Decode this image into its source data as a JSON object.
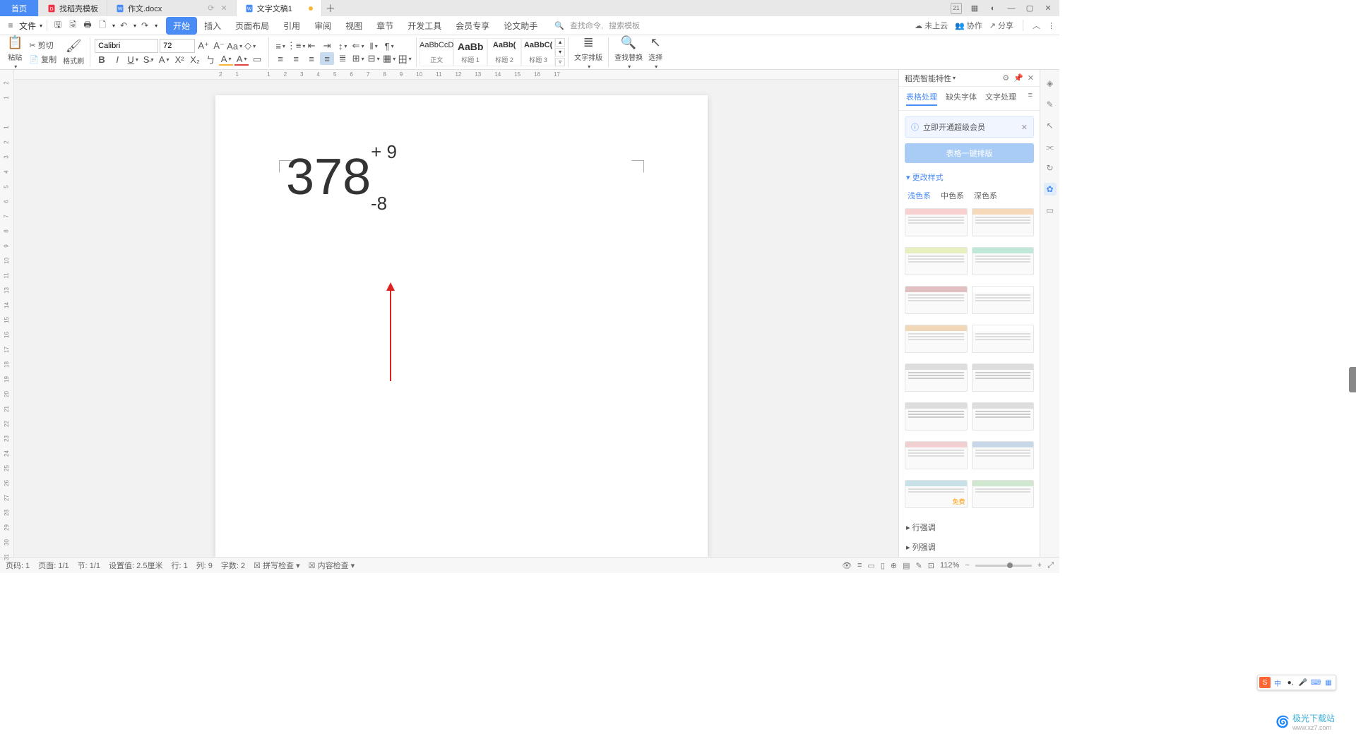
{
  "tabs": {
    "home": "首页",
    "t1": "找稻壳模板",
    "t2": "作文.docx",
    "t3": "文字文稿1"
  },
  "menu": {
    "file": "文件",
    "tabs": [
      "开始",
      "插入",
      "页面布局",
      "引用",
      "审阅",
      "视图",
      "章节",
      "开发工具",
      "会员专享",
      "论文助手"
    ],
    "search_cmd": "查找命令,",
    "search_tpl": "搜索模板",
    "cloud": "未上云",
    "coop": "协作",
    "share": "分享"
  },
  "ribbon": {
    "paste": "粘贴",
    "cut": "剪切",
    "copy": "复制",
    "format_painter": "格式刷",
    "font": "Calibri",
    "size": "72",
    "styles": {
      "s1": {
        "preview": "AaBbCcD",
        "label": "正文"
      },
      "s2": {
        "preview": "AaBb",
        "label": "标题 1"
      },
      "s3": {
        "preview": "AaBb(",
        "label": "标题 2"
      },
      "s4": {
        "preview": "AaBbC(",
        "label": "标题 3"
      }
    },
    "typeset": "文字排版",
    "find": "查找替换",
    "select": "选择"
  },
  "document": {
    "main": "378",
    "sup": "+ 9",
    "sub": "-8"
  },
  "panel": {
    "title": "稻壳智能特性",
    "tabs": [
      "表格处理",
      "缺失字体",
      "文字处理"
    ],
    "info": "立即开通超级会员",
    "action": "表格一键排版",
    "change_style": "更改样式",
    "color_tabs": [
      "浅色系",
      "中色系",
      "深色系"
    ],
    "free": "免费",
    "row_adjust": "行强调",
    "col_adjust": "列强调"
  },
  "status": {
    "page_num": "页码: 1",
    "page": "页面: 1/1",
    "section": "节: 1/1",
    "pos": "设置值: 2.5厘米",
    "line": "行: 1",
    "col": "列: 9",
    "words": "字数: 2",
    "spell": "拼写检查",
    "content": "内容检查",
    "zoom": "112%"
  }
}
